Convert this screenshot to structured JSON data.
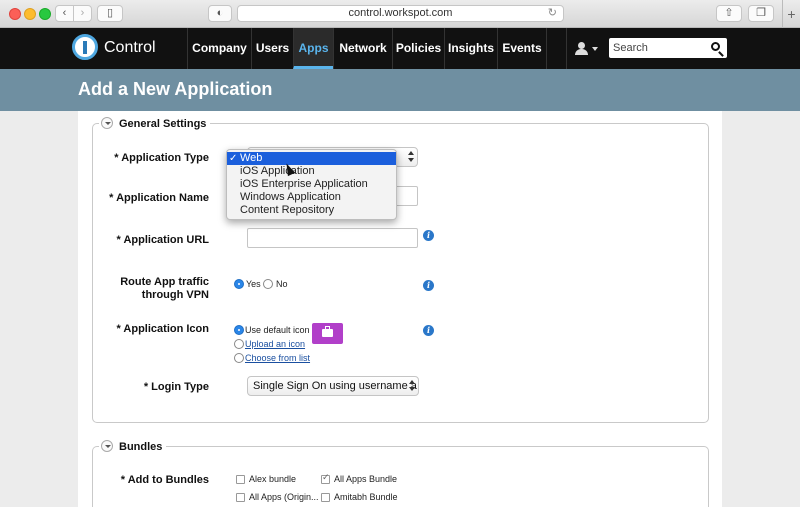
{
  "browser": {
    "url": "control.workspot.com"
  },
  "appnav": {
    "brand": "Control",
    "items": [
      "Company",
      "Users",
      "Apps",
      "Network",
      "Policies",
      "Insights",
      "Events"
    ],
    "active": "Apps",
    "search_placeholder": "Search"
  },
  "page": {
    "title": "Add a New Application"
  },
  "general": {
    "legend": "General Settings",
    "app_type_label": "* Application Type",
    "app_name_label": "* Application Name",
    "app_url_label": "* Application URL",
    "route_label_line1": "Route App traffic",
    "route_label_line2": "through VPN",
    "route_yes": "Yes",
    "route_no": "No",
    "icon_label": "* Application Icon",
    "icon_default": "Use default icon",
    "icon_upload": "Upload an icon",
    "icon_choose": "Choose from list",
    "login_label": "* Login Type",
    "login_value": "Single Sign On using username a"
  },
  "dropdown": {
    "options": [
      "Web",
      "iOS Application",
      "iOS Enterprise Application",
      "Windows Application",
      "Content Repository"
    ],
    "selected": "Web"
  },
  "bundles": {
    "legend": "Bundles",
    "add_label": "* Add to Bundles",
    "items": [
      {
        "label": "Alex bundle",
        "checked": false
      },
      {
        "label": "All Apps Bundle",
        "checked": true
      },
      {
        "label": "All Apps (Origin...",
        "checked": false
      },
      {
        "label": "Amitabh Bundle",
        "checked": false
      }
    ]
  },
  "colors": {
    "nav_bg": "#111111",
    "accent": "#5ab4ec",
    "title_band": "#6f8fa1",
    "icon_purple": "#b13fc9",
    "selection_blue": "#1b5fdc"
  }
}
